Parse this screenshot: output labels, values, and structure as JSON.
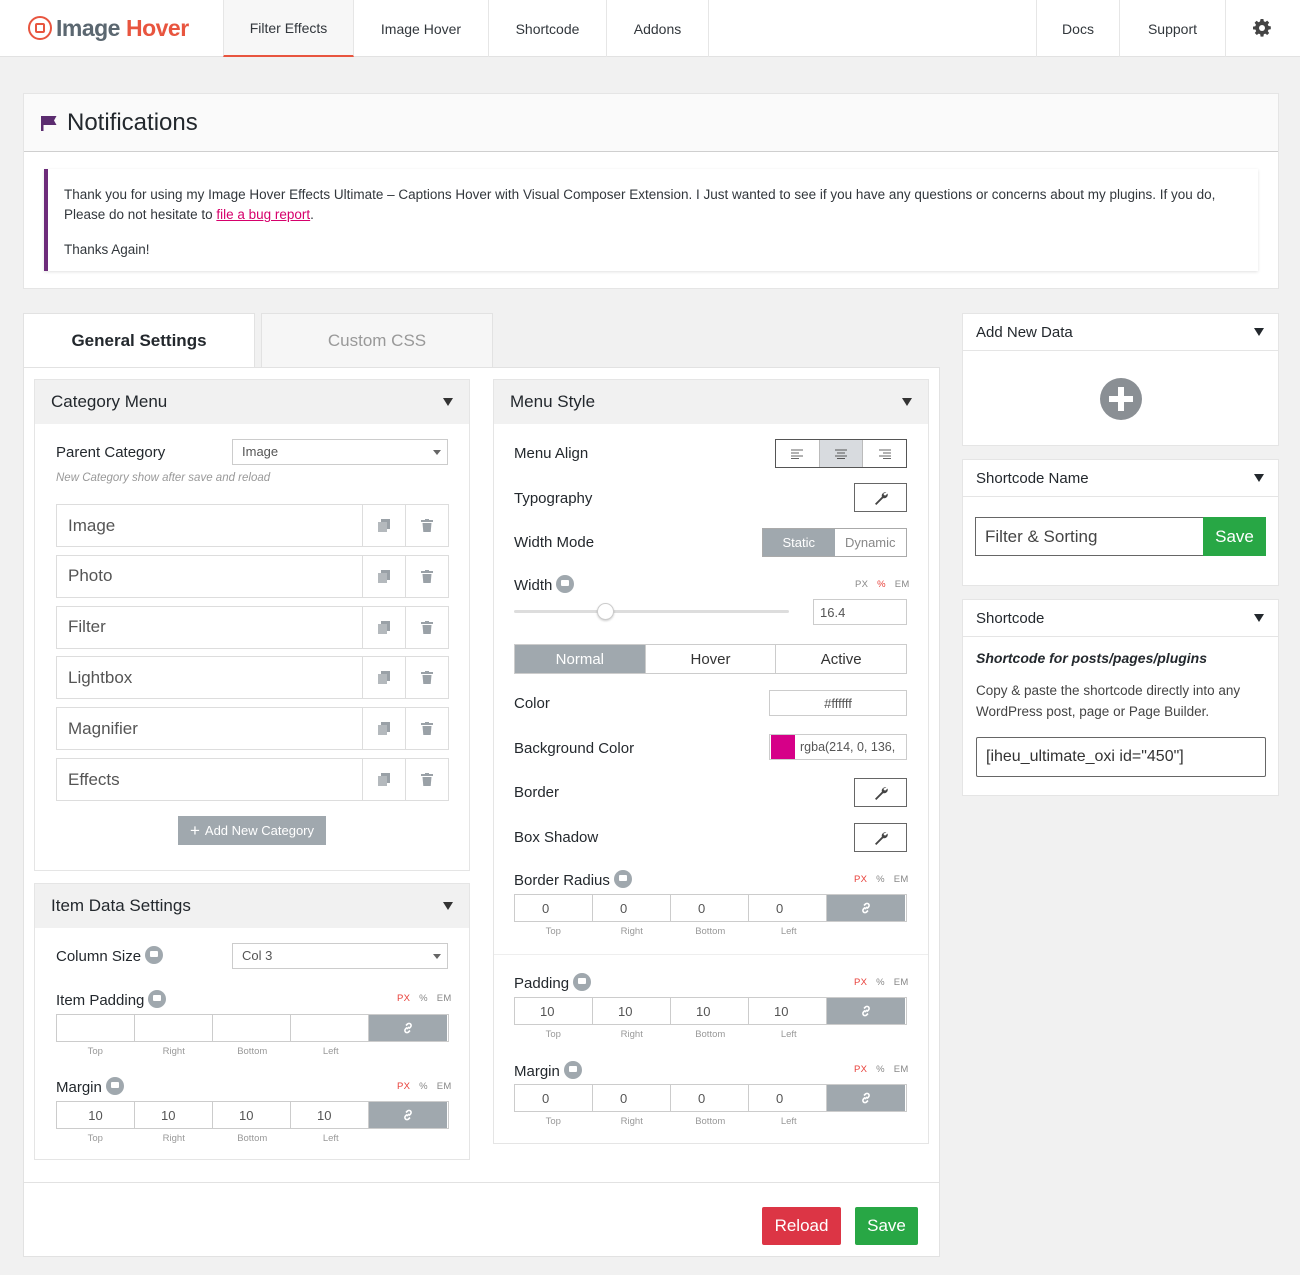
{
  "app": {
    "logo_part1": "Image",
    "logo_part2": "Hover",
    "brand_color": "#e8553f"
  },
  "nav": {
    "tabs": [
      "Filter Effects",
      "Image Hover",
      "Shortcode",
      "Addons"
    ],
    "active_tab": "Filter Effects",
    "docs": "Docs",
    "support": "Support",
    "settings_icon": "gear-icon"
  },
  "notifications": {
    "title": "Notifications",
    "message_before_link": "Thank you for using my Image Hover Effects Ultimate – Captions Hover with Visual Composer Extension. I Just wanted to see if you have any questions or concerns about my plugins. If you do, Please do not hesitate to ",
    "link_text": "file a bug report",
    "message_after_link": ".",
    "thanks": "Thanks Again!",
    "accent_color": "#6d2c7a"
  },
  "settings_tabs": [
    "General Settings",
    "Custom CSS"
  ],
  "category_menu": {
    "title": "Category Menu",
    "parent_label": "Parent Category",
    "parent_value": "Image",
    "hint": "New Category show after save and reload",
    "categories": [
      "Image",
      "Photo",
      "Filter",
      "Lightbox",
      "Magnifier",
      "Effects"
    ],
    "add_button": "Add New Category"
  },
  "item_data": {
    "title": "Item Data Settings",
    "column_label": "Column Size",
    "column_value": "Col 3",
    "padding_label": "Item Padding",
    "padding_values": [
      "",
      "",
      "",
      ""
    ],
    "margin_label": "Margin",
    "margin_values": [
      "10",
      "10",
      "10",
      "10"
    ]
  },
  "units": [
    "PX",
    "%",
    "EM"
  ],
  "dim_labels": [
    "Top",
    "Right",
    "Bottom",
    "Left"
  ],
  "menu_style": {
    "title": "Menu Style",
    "align_label": "Menu Align",
    "typography_label": "Typography",
    "width_mode_label": "Width Mode",
    "width_mode_options": [
      "Static",
      "Dynamic"
    ],
    "width_label": "Width",
    "width_value": "16.4",
    "width_slider_fraction": 0.33,
    "state_tabs": [
      "Normal",
      "Hover",
      "Active"
    ],
    "color_label": "Color",
    "color_value": "#ffffff",
    "bg_label": "Background Color",
    "bg_value": "rgba(214, 0, 136,",
    "bg_swatch": "#d60088",
    "border_label": "Border",
    "shadow_label": "Box Shadow",
    "radius_label": "Border Radius",
    "radius_values": [
      "0",
      "0",
      "0",
      "0"
    ],
    "padding_label": "Padding",
    "padding_values": [
      "10",
      "10",
      "10",
      "10"
    ],
    "margin_label": "Margin",
    "margin_values": [
      "0",
      "0",
      "0",
      "0"
    ]
  },
  "actions": {
    "reload": "Reload",
    "save": "Save"
  },
  "sidebar": {
    "add_new_title": "Add New Data",
    "shortcode_name_title": "Shortcode Name",
    "shortcode_name_value": "Filter & Sorting",
    "shortcode_name_save": "Save",
    "shortcode_title": "Shortcode",
    "shortcode_subtitle": "Shortcode for posts/pages/plugins",
    "shortcode_desc": "Copy & paste the shortcode directly into any WordPress post, page or Page Builder.",
    "shortcode_value": "[iheu_ultimate_oxi id=\"450\"]"
  }
}
